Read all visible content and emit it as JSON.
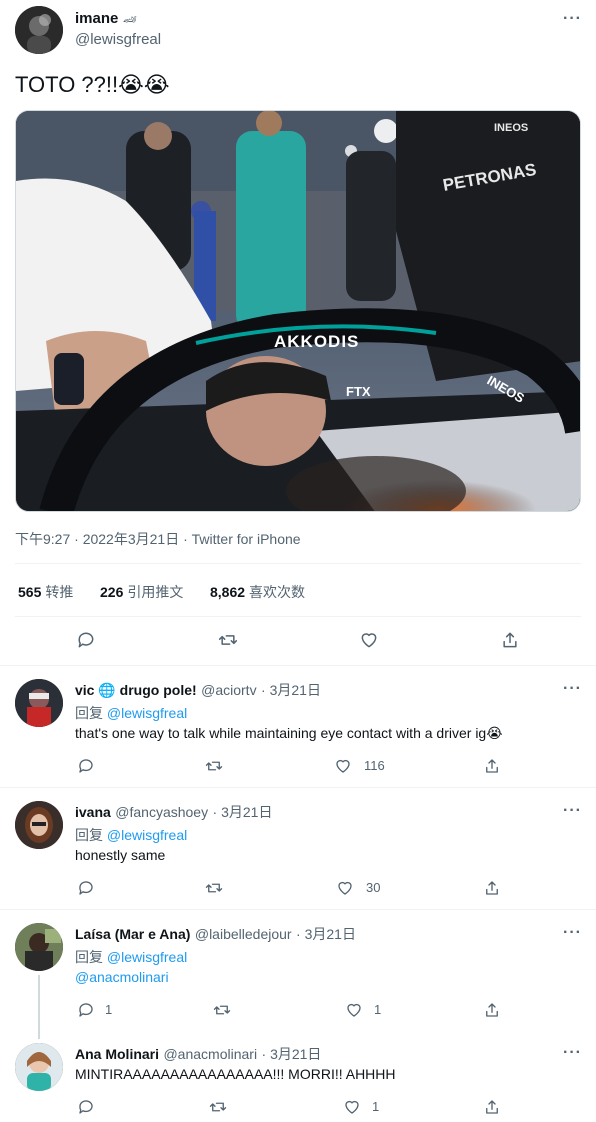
{
  "main": {
    "author_name": "imane",
    "author_badge": "🏎",
    "author_handle": "@lewisgfreal",
    "more": "···",
    "text": "TOTO ??!!😭😭",
    "photo_texts": {
      "halo": "AKKODIS",
      "petronas": "PETRONAS",
      "ineos": "INEOS",
      "ftx": "FTX"
    },
    "timestamp": "下午9:27 · 2022年3月21日 · Twitter for iPhone",
    "stats": {
      "retweets_count": "565",
      "retweets_label": "转推",
      "quotes_count": "226",
      "quotes_label": "引用推文",
      "likes_count": "8,862",
      "likes_label": "喜欢次数"
    }
  },
  "replies": [
    {
      "name": "vic 🌐 drugo pole!",
      "handle": "@aciortv",
      "date": "· 3月21日",
      "reply_prefix": "回复",
      "reply_to": "@lewisgfreal",
      "text": "that's one way to talk while maintaining eye contact with a driver ig😭",
      "reply_count": "",
      "retweet_count": "",
      "like_count": "116"
    },
    {
      "name": "ivana",
      "handle": "@fancyashoey",
      "date": "· 3月21日",
      "reply_prefix": "回复",
      "reply_to": "@lewisgfreal",
      "text": "honestly same",
      "reply_count": "",
      "retweet_count": "",
      "like_count": "30"
    },
    {
      "name": "Laísa (Mar e Ana)",
      "handle": "@laibelledejour",
      "date": "· 3月21日",
      "reply_prefix": "回复",
      "reply_to": "@lewisgfreal",
      "text": "@anacmolinari",
      "reply_count": "1",
      "retweet_count": "",
      "like_count": "1"
    },
    {
      "name": "Ana Molinari",
      "handle": "@anacmolinari",
      "date": "· 3月21日",
      "reply_prefix": "",
      "reply_to": "",
      "text": "MINTIRAAAAAAAAAAAAAAAA!!! MORRI!! AHHHH",
      "reply_count": "",
      "retweet_count": "",
      "like_count": "1"
    }
  ],
  "colors": {
    "text": "#0f1419",
    "muted": "#536471",
    "link": "#1d9bf0",
    "divider": "#eff3f4"
  },
  "icons": [
    "reply-icon",
    "retweet-icon",
    "like-icon",
    "share-icon",
    "more-icon"
  ]
}
